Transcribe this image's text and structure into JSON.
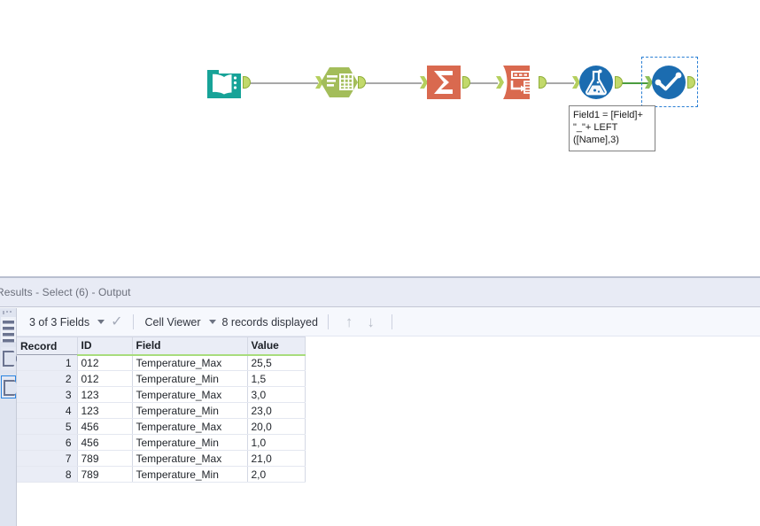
{
  "canvas": {
    "nodes": [
      {
        "id": "input-data",
        "name": "input-data-tool",
        "icon": "book-open-icon",
        "color": "#17a398",
        "type": "input"
      },
      {
        "id": "select",
        "name": "select-tool",
        "icon": "select-table-icon",
        "color": "#a3bd5a",
        "type": "select"
      },
      {
        "id": "summarize",
        "name": "summarize-tool",
        "icon": "sigma-icon",
        "color": "#d9694f",
        "type": "summarize"
      },
      {
        "id": "crosstab",
        "name": "crosstab-tool",
        "icon": "crosstab-icon",
        "color": "#d9694f",
        "type": "crosstab"
      },
      {
        "id": "formula",
        "name": "formula-tool",
        "icon": "flask-icon",
        "color": "#1b6cb0",
        "type": "formula"
      },
      {
        "id": "browse",
        "name": "browse-tool",
        "icon": "browse-chart-icon",
        "color": "#1b6cb0",
        "type": "browse",
        "selected": true
      }
    ],
    "annotation": "Field1 = [Field]+\n\"_\"+ LEFT\n([Name],3)",
    "wire_color": "#a8a8a8",
    "active_wire_color": "#4a9c3f",
    "selection_color": "#2a7fd4"
  },
  "results": {
    "title": "Results - Select (6) - Output",
    "toolbar": {
      "fields_label": "3 of 3 Fields",
      "check_icon": "check-icon",
      "viewer_label": "Cell Viewer",
      "records_label": "8 records displayed",
      "up_arrow": "↑",
      "down_arrow": "↓"
    },
    "rail": {
      "grip": "grip-dots-icon",
      "lines_icon": "data-lines-icon",
      "anchor_icon_1": "anchor-hexagon-icon",
      "anchor_icon_2": "anchor-hexagon-icon-selected"
    },
    "grid": {
      "columns": [
        "Record",
        "ID",
        "Field",
        "Value"
      ],
      "rows": [
        {
          "record": "1",
          "id": "012",
          "field": "Temperature_Max",
          "value": "25,5"
        },
        {
          "record": "2",
          "id": "012",
          "field": "Temperature_Min",
          "value": "1,5"
        },
        {
          "record": "3",
          "id": "123",
          "field": "Temperature_Max",
          "value": "3,0"
        },
        {
          "record": "4",
          "id": "123",
          "field": "Temperature_Min",
          "value": "23,0"
        },
        {
          "record": "5",
          "id": "456",
          "field": "Temperature_Max",
          "value": "20,0"
        },
        {
          "record": "6",
          "id": "456",
          "field": "Temperature_Min",
          "value": "1,0"
        },
        {
          "record": "7",
          "id": "789",
          "field": "Temperature_Max",
          "value": "21,0"
        },
        {
          "record": "8",
          "id": "789",
          "field": "Temperature_Min",
          "value": "2,0"
        }
      ]
    }
  }
}
